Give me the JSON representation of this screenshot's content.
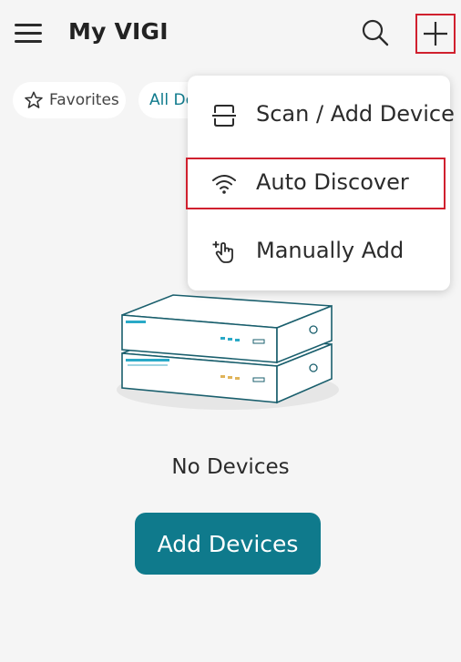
{
  "header": {
    "title": "My VIGI",
    "menu_icon": "hamburger-menu-icon",
    "search_icon": "search-icon",
    "add_icon": "plus-icon"
  },
  "filters": {
    "favorites_label": "Favorites",
    "all_label": "All Devices"
  },
  "dropdown": {
    "items": [
      {
        "label": "Scan / Add Device",
        "icon": "scan-icon"
      },
      {
        "label": "Auto Discover",
        "icon": "wifi-icon"
      },
      {
        "label": "Manually Add",
        "icon": "tap-add-icon"
      }
    ]
  },
  "empty_state": {
    "illustration": "stacked-devices-illustration",
    "message": "No Devices",
    "button_label": "Add Devices"
  },
  "colors": {
    "accent": "#0f7a8c",
    "highlight": "#d0202e",
    "background": "#f5f5f5"
  }
}
